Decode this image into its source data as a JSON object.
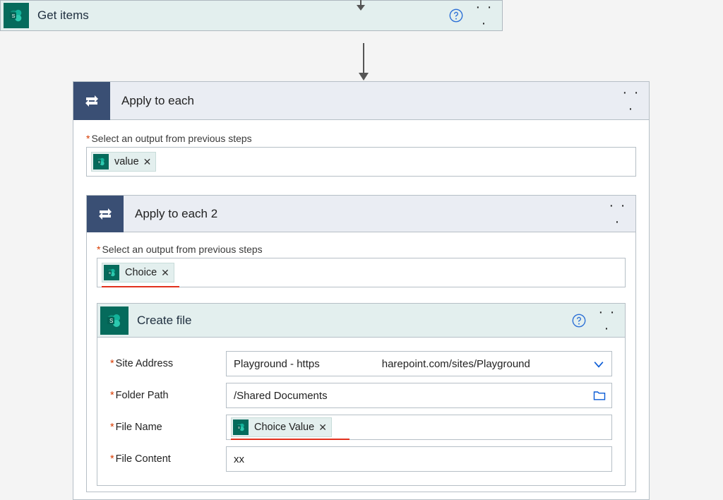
{
  "getItems": {
    "title": "Get items"
  },
  "applyToEach": {
    "title": "Apply to each",
    "selectLabel": "Select an output from previous steps",
    "token": "value"
  },
  "applyToEach2": {
    "title": "Apply to each 2",
    "selectLabel": "Select an output from previous steps",
    "token": "Choice"
  },
  "createFile": {
    "title": "Create file",
    "siteAddress": {
      "label": "Site Address",
      "left": "Playground - https",
      "right": "harepoint.com/sites/Playground"
    },
    "folderPath": {
      "label": "Folder Path",
      "value": "/Shared Documents"
    },
    "fileName": {
      "label": "File Name",
      "token": "Choice Value"
    },
    "fileContent": {
      "label": "File Content",
      "value": "xx"
    }
  }
}
